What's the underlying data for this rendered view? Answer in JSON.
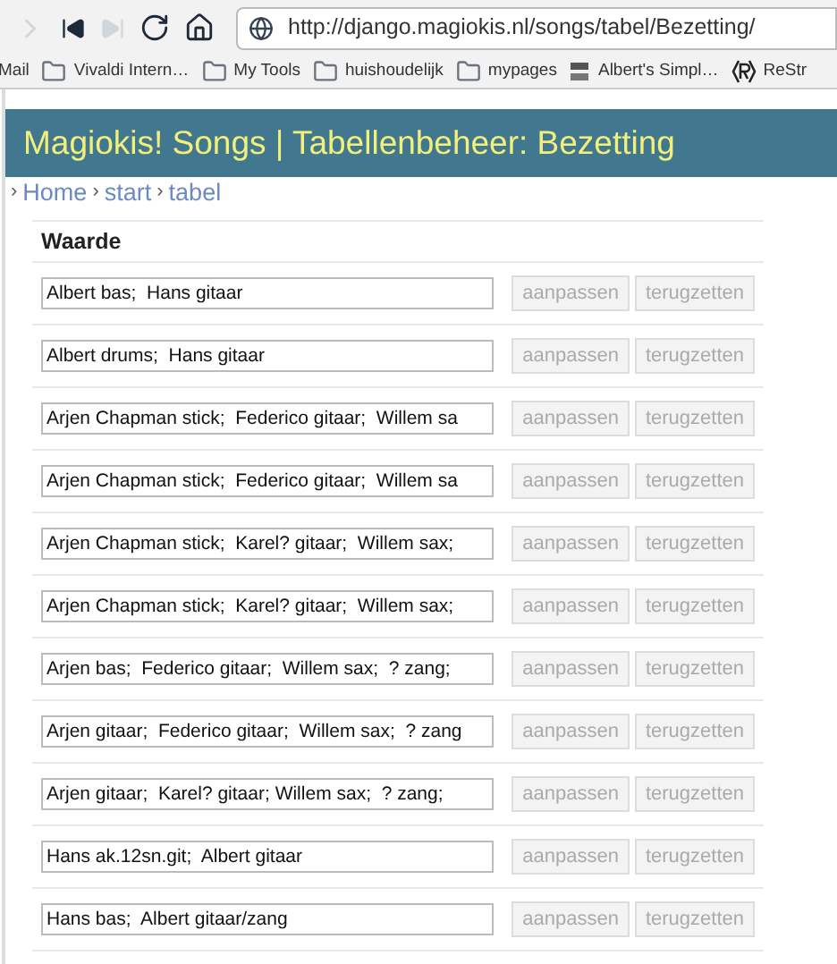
{
  "browser": {
    "url": "http://django.magiokis.nl/songs/tabel/Bezetting/",
    "bookmarks": [
      {
        "label": "Mail",
        "kind": "plain"
      },
      {
        "label": "Vivaldi Intern…",
        "kind": "folder"
      },
      {
        "label": "My Tools",
        "kind": "folder"
      },
      {
        "label": "huishoudelijk",
        "kind": "folder"
      },
      {
        "label": "mypages",
        "kind": "folder"
      },
      {
        "label": "Albert's Simpl…",
        "kind": "site"
      },
      {
        "label": "ReStr",
        "kind": "restructured"
      }
    ]
  },
  "header": {
    "title": "Magiokis! Songs | Tabellenbeheer: Bezetting"
  },
  "breadcrumb": [
    {
      "separator": "›",
      "label": "Home"
    },
    {
      "separator": "›",
      "label": "start"
    },
    {
      "separator": "›",
      "label": "tabel"
    }
  ],
  "table": {
    "column": "Waarde",
    "rows": [
      {
        "value": "Albert bas;  Hans gitaar",
        "buttons": [
          {
            "label": "aanpassen",
            "disabled": true
          },
          {
            "label": "terugzetten",
            "disabled": true
          }
        ]
      },
      {
        "value": "Albert drums;  Hans gitaar",
        "buttons": [
          {
            "label": "aanpassen",
            "disabled": true
          },
          {
            "label": "terugzetten",
            "disabled": true
          }
        ]
      },
      {
        "value": "Arjen Chapman stick;  Federico gitaar;  Willem sa",
        "buttons": [
          {
            "label": "aanpassen",
            "disabled": true
          },
          {
            "label": "terugzetten",
            "disabled": true
          }
        ]
      },
      {
        "value": "Arjen Chapman stick;  Federico gitaar;  Willem sa",
        "buttons": [
          {
            "label": "aanpassen",
            "disabled": true
          },
          {
            "label": "terugzetten",
            "disabled": true
          }
        ]
      },
      {
        "value": "Arjen Chapman stick;  Karel? gitaar;  Willem sax;",
        "buttons": [
          {
            "label": "aanpassen",
            "disabled": true
          },
          {
            "label": "terugzetten",
            "disabled": true
          }
        ]
      },
      {
        "value": "Arjen Chapman stick;  Karel? gitaar;  Willem sax;",
        "buttons": [
          {
            "label": "aanpassen",
            "disabled": true
          },
          {
            "label": "terugzetten",
            "disabled": true
          }
        ]
      },
      {
        "value": "Arjen bas;  Federico gitaar;  Willem sax;  ? zang;",
        "buttons": [
          {
            "label": "aanpassen",
            "disabled": true
          },
          {
            "label": "terugzetten",
            "disabled": true
          }
        ]
      },
      {
        "value": "Arjen gitaar;  Federico gitaar;  Willem sax;  ? zang",
        "buttons": [
          {
            "label": "aanpassen",
            "disabled": true
          },
          {
            "label": "terugzetten",
            "disabled": true
          }
        ]
      },
      {
        "value": "Arjen gitaar;  Karel? gitaar; Willem sax;  ? zang;",
        "buttons": [
          {
            "label": "aanpassen",
            "disabled": true
          },
          {
            "label": "terugzetten",
            "disabled": true
          }
        ]
      },
      {
        "value": "Hans ak.12sn.git;  Albert gitaar",
        "buttons": [
          {
            "label": "aanpassen",
            "disabled": true
          },
          {
            "label": "terugzetten",
            "disabled": true
          }
        ]
      },
      {
        "value": "Hans bas;  Albert gitaar/zang",
        "buttons": [
          {
            "label": "aanpassen",
            "disabled": true
          },
          {
            "label": "terugzetten",
            "disabled": true
          }
        ]
      }
    ]
  }
}
